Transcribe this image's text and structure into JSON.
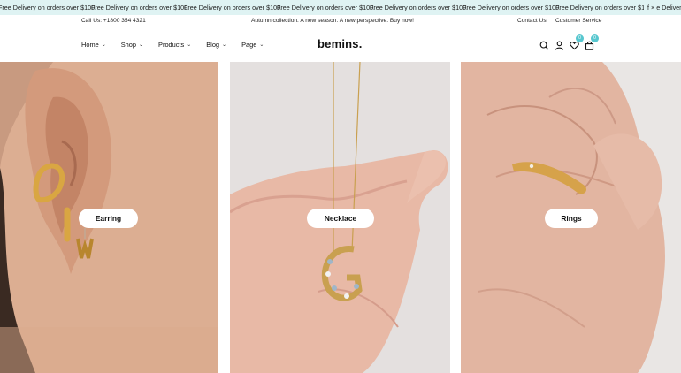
{
  "announcement": {
    "messages": [
      "Free Delivery on orders over $100.",
      "Free Delivery on orders over $100.",
      "Free Delivery on orders over $100.",
      "Free Delivery on orders over $100.",
      "Free Delivery on orders over $100.",
      "Free Delivery on orders over $100.",
      "Free Delivery on orders over $100."
    ],
    "close_text": "f × e Delivery"
  },
  "topbar": {
    "phone": "Call Us: +1800 354 4321",
    "promo": "Autumn collection. A new season. A new perspective. Buy now!",
    "contact": "Contact Us",
    "service": "Customer Service"
  },
  "header": {
    "logo": "bemins.",
    "nav": [
      "Home",
      "Shop",
      "Products",
      "Blog",
      "Page"
    ],
    "wishlist_count": "0",
    "cart_count": "0"
  },
  "categories": [
    {
      "label": "Earring"
    },
    {
      "label": "Necklace"
    },
    {
      "label": "Rings"
    }
  ],
  "colors": {
    "ticker_bg": "#dff3f3",
    "badge": "#57c7cf"
  },
  "icons": [
    "search-icon",
    "user-icon",
    "heart-icon",
    "bag-icon",
    "chevron-down-icon"
  ]
}
